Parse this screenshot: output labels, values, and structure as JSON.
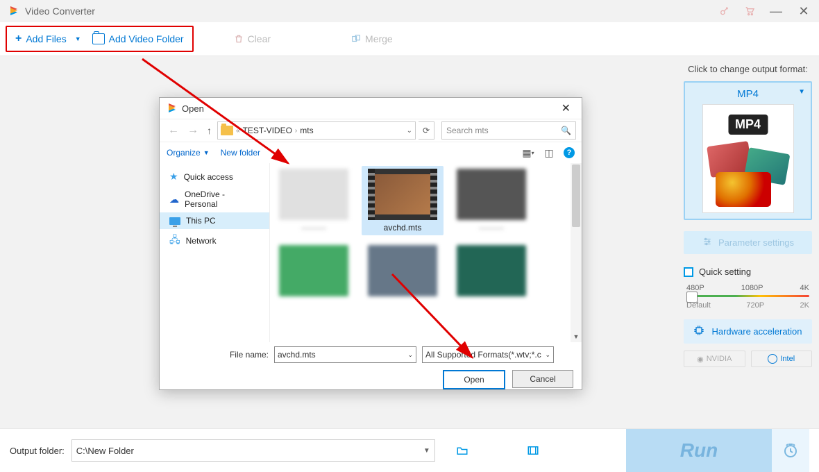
{
  "titlebar": {
    "app_name": "Video Converter"
  },
  "toolbar": {
    "add_files": "Add Files",
    "add_folder": "Add Video Folder",
    "clear": "Clear",
    "merge": "Merge"
  },
  "sidebar": {
    "hint": "Click to change output format:",
    "format_label": "MP4",
    "format_badge": "MP4",
    "param_settings": "Parameter settings",
    "quick_setting": "Quick setting",
    "slider_top": [
      "480P",
      "1080P",
      "4K"
    ],
    "slider_bottom": [
      "Default",
      "720P",
      "2K"
    ],
    "hw_accel": "Hardware acceleration",
    "nvidia": "NVIDIA",
    "intel": "Intel"
  },
  "dialog": {
    "title": "Open",
    "breadcrumb": {
      "sep_left": "«",
      "folder1": "TEST-VIDEO",
      "folder2": "mts"
    },
    "search_placeholder": "Search mts",
    "organize": "Organize",
    "new_folder": "New folder",
    "side": {
      "quick_access": "Quick access",
      "onedrive": "OneDrive - Personal",
      "this_pc": "This PC",
      "network": "Network"
    },
    "selected_file": "avchd.mts",
    "file_name_label": "File name:",
    "file_name_value": "avchd.mts",
    "filter": "All Supported Formats(*.wtv;*.c",
    "open": "Open",
    "cancel": "Cancel"
  },
  "bottombar": {
    "output_label": "Output folder:",
    "output_path": "C:\\New Folder",
    "run": "Run"
  }
}
